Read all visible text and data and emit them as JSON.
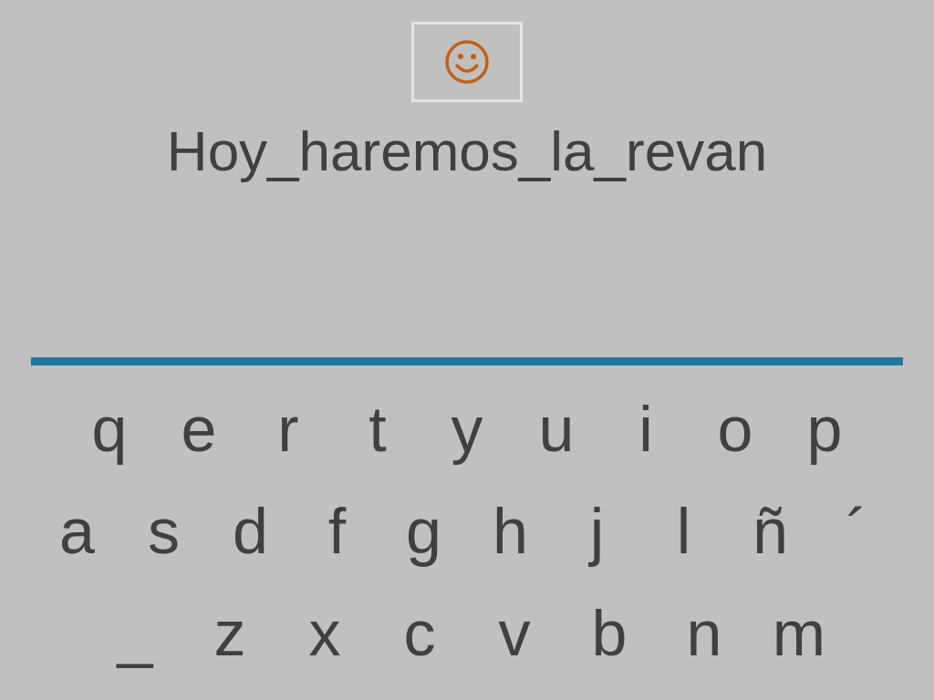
{
  "answer": "Hoy_haremos_la_revan",
  "keyboard": {
    "rows": [
      {
        "keys": [
          "q",
          "e",
          "r",
          "t",
          "y",
          "u",
          "i",
          "o",
          "p"
        ]
      },
      {
        "keys": [
          "a",
          "s",
          "d",
          "f",
          "g",
          "h",
          "j",
          "l",
          "ñ",
          "´"
        ]
      },
      {
        "keys": [
          "_",
          "z",
          "x",
          "c",
          "v",
          "b",
          "n",
          "m"
        ]
      }
    ]
  }
}
